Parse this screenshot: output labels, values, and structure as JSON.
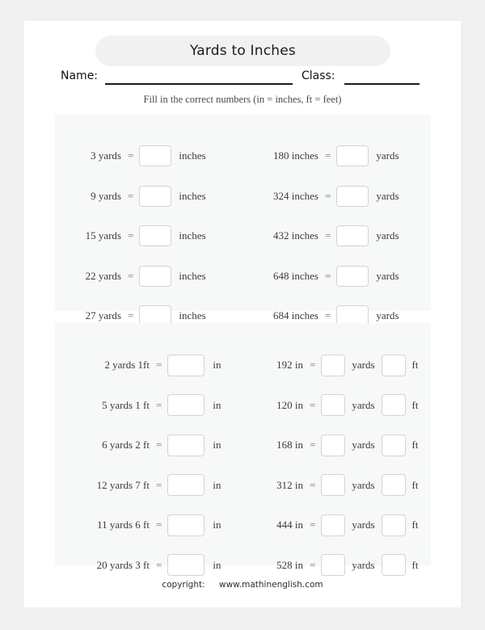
{
  "worksheet": {
    "title": "Yards to Inches",
    "name_label": "Name:",
    "class_label": "Class:",
    "instructions": "Fill in the correct numbers (in = inches, ft = feet)",
    "footer": {
      "copyright_label": "copyright:",
      "site": "www.mathinenglish.com"
    },
    "equals_sign": "=",
    "colors": {
      "page_background": "#ffffff",
      "outer_background": "#f0f0f0",
      "panel_background": "#f7f8f8",
      "title_pill_background": "#f1f1f1",
      "box_border": "#d2d4d4",
      "text": "#3b3b3b"
    }
  },
  "section1": {
    "left_rows": [
      {
        "prompt": "3 yards",
        "unit": "inches",
        "answer": ""
      },
      {
        "prompt": "9 yards",
        "unit": "inches",
        "answer": ""
      },
      {
        "prompt": "15 yards",
        "unit": "inches",
        "answer": ""
      },
      {
        "prompt": "22 yards",
        "unit": "inches",
        "answer": ""
      },
      {
        "prompt": "27 yards",
        "unit": "inches",
        "answer": ""
      }
    ],
    "right_rows": [
      {
        "prompt": "180 inches",
        "unit": "yards",
        "answer": ""
      },
      {
        "prompt": "324 inches",
        "unit": "yards",
        "answer": ""
      },
      {
        "prompt": "432 inches",
        "unit": "yards",
        "answer": ""
      },
      {
        "prompt": "648 inches",
        "unit": "yards",
        "answer": ""
      },
      {
        "prompt": "684 inches",
        "unit": "yards",
        "answer": ""
      }
    ]
  },
  "section2": {
    "left_rows": [
      {
        "prompt": "2 yards 1ft",
        "unit": "in",
        "answer": ""
      },
      {
        "prompt": "5 yards 1 ft",
        "unit": "in",
        "answer": ""
      },
      {
        "prompt": "6 yards 2 ft",
        "unit": "in",
        "answer": ""
      },
      {
        "prompt": "12 yards 7 ft",
        "unit": "in",
        "answer": ""
      },
      {
        "prompt": "11 yards 6 ft",
        "unit": "in",
        "answer": ""
      },
      {
        "prompt": "20 yards 3 ft",
        "unit": "in",
        "answer": ""
      }
    ],
    "right_rows": [
      {
        "prompt": "192 in",
        "unit1": "yards",
        "unit2": "ft",
        "answer1": "",
        "answer2": ""
      },
      {
        "prompt": "120 in",
        "unit1": "yards",
        "unit2": "ft",
        "answer1": "",
        "answer2": ""
      },
      {
        "prompt": "168 in",
        "unit1": "yards",
        "unit2": "ft",
        "answer1": "",
        "answer2": ""
      },
      {
        "prompt": "312 in",
        "unit1": "yards",
        "unit2": "ft",
        "answer1": "",
        "answer2": ""
      },
      {
        "prompt": "444 in",
        "unit1": "yards",
        "unit2": "ft",
        "answer1": "",
        "answer2": ""
      },
      {
        "prompt": "528 in",
        "unit1": "yards",
        "unit2": "ft",
        "answer1": "",
        "answer2": ""
      }
    ]
  }
}
